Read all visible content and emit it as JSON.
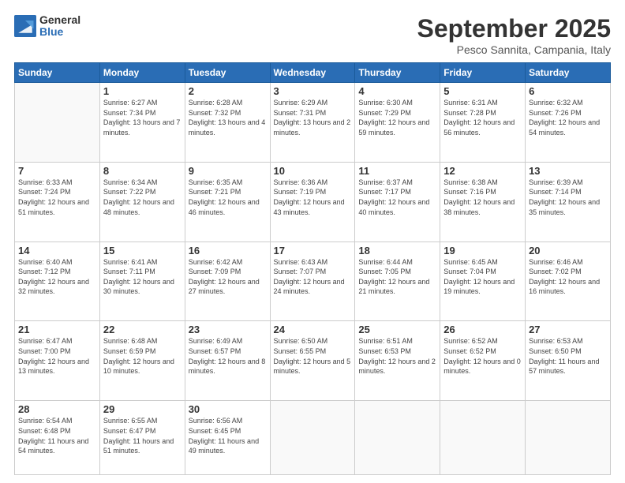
{
  "logo": {
    "general": "General",
    "blue": "Blue"
  },
  "title": "September 2025",
  "location": "Pesco Sannita, Campania, Italy",
  "weekdays": [
    "Sunday",
    "Monday",
    "Tuesday",
    "Wednesday",
    "Thursday",
    "Friday",
    "Saturday"
  ],
  "days": [
    {
      "num": "",
      "sunrise": "",
      "sunset": "",
      "daylight": ""
    },
    {
      "num": "1",
      "sunrise": "Sunrise: 6:27 AM",
      "sunset": "Sunset: 7:34 PM",
      "daylight": "Daylight: 13 hours and 7 minutes."
    },
    {
      "num": "2",
      "sunrise": "Sunrise: 6:28 AM",
      "sunset": "Sunset: 7:32 PM",
      "daylight": "Daylight: 13 hours and 4 minutes."
    },
    {
      "num": "3",
      "sunrise": "Sunrise: 6:29 AM",
      "sunset": "Sunset: 7:31 PM",
      "daylight": "Daylight: 13 hours and 2 minutes."
    },
    {
      "num": "4",
      "sunrise": "Sunrise: 6:30 AM",
      "sunset": "Sunset: 7:29 PM",
      "daylight": "Daylight: 12 hours and 59 minutes."
    },
    {
      "num": "5",
      "sunrise": "Sunrise: 6:31 AM",
      "sunset": "Sunset: 7:28 PM",
      "daylight": "Daylight: 12 hours and 56 minutes."
    },
    {
      "num": "6",
      "sunrise": "Sunrise: 6:32 AM",
      "sunset": "Sunset: 7:26 PM",
      "daylight": "Daylight: 12 hours and 54 minutes."
    },
    {
      "num": "7",
      "sunrise": "Sunrise: 6:33 AM",
      "sunset": "Sunset: 7:24 PM",
      "daylight": "Daylight: 12 hours and 51 minutes."
    },
    {
      "num": "8",
      "sunrise": "Sunrise: 6:34 AM",
      "sunset": "Sunset: 7:22 PM",
      "daylight": "Daylight: 12 hours and 48 minutes."
    },
    {
      "num": "9",
      "sunrise": "Sunrise: 6:35 AM",
      "sunset": "Sunset: 7:21 PM",
      "daylight": "Daylight: 12 hours and 46 minutes."
    },
    {
      "num": "10",
      "sunrise": "Sunrise: 6:36 AM",
      "sunset": "Sunset: 7:19 PM",
      "daylight": "Daylight: 12 hours and 43 minutes."
    },
    {
      "num": "11",
      "sunrise": "Sunrise: 6:37 AM",
      "sunset": "Sunset: 7:17 PM",
      "daylight": "Daylight: 12 hours and 40 minutes."
    },
    {
      "num": "12",
      "sunrise": "Sunrise: 6:38 AM",
      "sunset": "Sunset: 7:16 PM",
      "daylight": "Daylight: 12 hours and 38 minutes."
    },
    {
      "num": "13",
      "sunrise": "Sunrise: 6:39 AM",
      "sunset": "Sunset: 7:14 PM",
      "daylight": "Daylight: 12 hours and 35 minutes."
    },
    {
      "num": "14",
      "sunrise": "Sunrise: 6:40 AM",
      "sunset": "Sunset: 7:12 PM",
      "daylight": "Daylight: 12 hours and 32 minutes."
    },
    {
      "num": "15",
      "sunrise": "Sunrise: 6:41 AM",
      "sunset": "Sunset: 7:11 PM",
      "daylight": "Daylight: 12 hours and 30 minutes."
    },
    {
      "num": "16",
      "sunrise": "Sunrise: 6:42 AM",
      "sunset": "Sunset: 7:09 PM",
      "daylight": "Daylight: 12 hours and 27 minutes."
    },
    {
      "num": "17",
      "sunrise": "Sunrise: 6:43 AM",
      "sunset": "Sunset: 7:07 PM",
      "daylight": "Daylight: 12 hours and 24 minutes."
    },
    {
      "num": "18",
      "sunrise": "Sunrise: 6:44 AM",
      "sunset": "Sunset: 7:05 PM",
      "daylight": "Daylight: 12 hours and 21 minutes."
    },
    {
      "num": "19",
      "sunrise": "Sunrise: 6:45 AM",
      "sunset": "Sunset: 7:04 PM",
      "daylight": "Daylight: 12 hours and 19 minutes."
    },
    {
      "num": "20",
      "sunrise": "Sunrise: 6:46 AM",
      "sunset": "Sunset: 7:02 PM",
      "daylight": "Daylight: 12 hours and 16 minutes."
    },
    {
      "num": "21",
      "sunrise": "Sunrise: 6:47 AM",
      "sunset": "Sunset: 7:00 PM",
      "daylight": "Daylight: 12 hours and 13 minutes."
    },
    {
      "num": "22",
      "sunrise": "Sunrise: 6:48 AM",
      "sunset": "Sunset: 6:59 PM",
      "daylight": "Daylight: 12 hours and 10 minutes."
    },
    {
      "num": "23",
      "sunrise": "Sunrise: 6:49 AM",
      "sunset": "Sunset: 6:57 PM",
      "daylight": "Daylight: 12 hours and 8 minutes."
    },
    {
      "num": "24",
      "sunrise": "Sunrise: 6:50 AM",
      "sunset": "Sunset: 6:55 PM",
      "daylight": "Daylight: 12 hours and 5 minutes."
    },
    {
      "num": "25",
      "sunrise": "Sunrise: 6:51 AM",
      "sunset": "Sunset: 6:53 PM",
      "daylight": "Daylight: 12 hours and 2 minutes."
    },
    {
      "num": "26",
      "sunrise": "Sunrise: 6:52 AM",
      "sunset": "Sunset: 6:52 PM",
      "daylight": "Daylight: 12 hours and 0 minutes."
    },
    {
      "num": "27",
      "sunrise": "Sunrise: 6:53 AM",
      "sunset": "Sunset: 6:50 PM",
      "daylight": "Daylight: 11 hours and 57 minutes."
    },
    {
      "num": "28",
      "sunrise": "Sunrise: 6:54 AM",
      "sunset": "Sunset: 6:48 PM",
      "daylight": "Daylight: 11 hours and 54 minutes."
    },
    {
      "num": "29",
      "sunrise": "Sunrise: 6:55 AM",
      "sunset": "Sunset: 6:47 PM",
      "daylight": "Daylight: 11 hours and 51 minutes."
    },
    {
      "num": "30",
      "sunrise": "Sunrise: 6:56 AM",
      "sunset": "Sunset: 6:45 PM",
      "daylight": "Daylight: 11 hours and 49 minutes."
    }
  ]
}
